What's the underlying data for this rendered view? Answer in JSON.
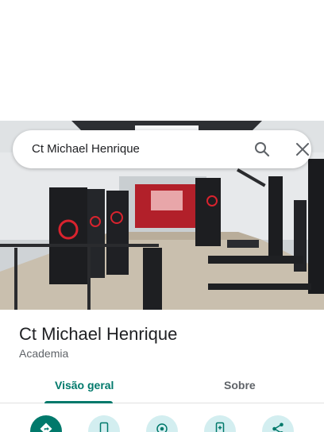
{
  "search": {
    "query": "Ct Michael Henrique"
  },
  "place": {
    "name": "Ct Michael Henrique",
    "category": "Academia"
  },
  "tabs": [
    {
      "label": "Visão geral",
      "active": true
    },
    {
      "label": "Sobre",
      "active": false
    }
  ],
  "actions": [
    {
      "icon": "directions-icon",
      "primary": true
    },
    {
      "icon": "phone-icon"
    },
    {
      "icon": "location-icon"
    },
    {
      "icon": "add-to-phone-icon"
    },
    {
      "icon": "share-icon"
    }
  ],
  "colors": {
    "accent": "#00796b",
    "action_bg": "#d3eef0",
    "brand_red": "#d9232e"
  }
}
